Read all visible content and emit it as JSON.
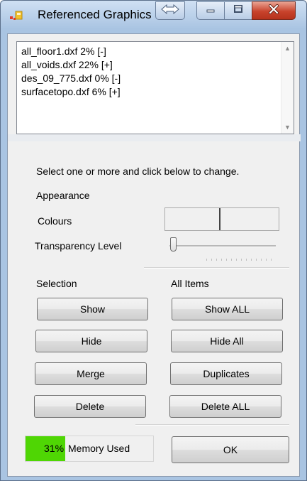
{
  "window": {
    "title": "Referenced Graphics"
  },
  "list": {
    "items": [
      "all_floor1.dxf 2%  [-]",
      "all_voids.dxf 22%  [+]",
      "des_09_775.dxf 0%  [-]",
      "surfacetopo.dxf 6%  [+]"
    ]
  },
  "instructions": "Select one or more and click below to change.",
  "appearance": {
    "heading": "Appearance",
    "colours_label": "Colours",
    "transparency_label": "Transparency Level",
    "transparency_value": 0
  },
  "selection": {
    "heading": "Selection",
    "show": "Show",
    "hide": "Hide",
    "merge": "Merge",
    "delete": "Delete"
  },
  "all_items": {
    "heading": "All Items",
    "show_all": "Show ALL",
    "hide_all": "Hide All",
    "duplicates": "Duplicates",
    "delete_all": "Delete ALL"
  },
  "memory": {
    "percent": 31,
    "percent_label": "31%",
    "label": "Memory Used",
    "fill_color": "#4fd604"
  },
  "ok_label": "OK",
  "icons": {
    "app": "referenced-graphics-icon",
    "swap": "swap-arrows-icon",
    "minimize": "minimize-icon",
    "maximize": "maximize-icon",
    "close": "close-icon"
  }
}
